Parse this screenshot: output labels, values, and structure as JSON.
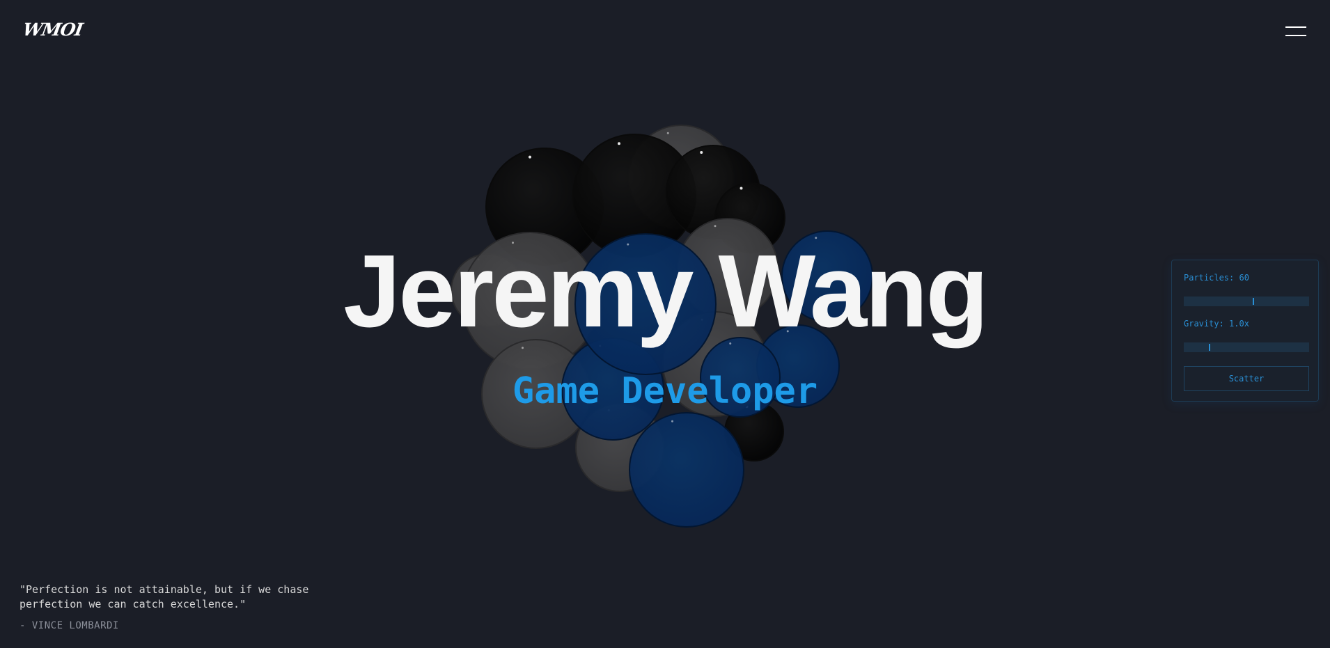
{
  "header": {
    "logo": "WMOI",
    "menu_icon": "hamburger-menu-icon"
  },
  "hero": {
    "name": "Jeremy Wang",
    "role": "Game Developer"
  },
  "controls": {
    "particles_label": "Particles: 60",
    "particles_level": 0.55,
    "gravity_label": "Gravity: 1.0x",
    "gravity_level": 0.2,
    "scatter_label": "Scatter"
  },
  "quote": {
    "text": "\"Perfection is not attainable, but if we chase perfection we can catch excellence.\"",
    "author": "- VINCE LOMBARDI"
  },
  "colors": {
    "background": "#1b1e27",
    "accent": "#1e9be8",
    "bubble_blue": "#062a55",
    "bubble_gray": "#3e3e40",
    "bubble_black": "#050505"
  }
}
